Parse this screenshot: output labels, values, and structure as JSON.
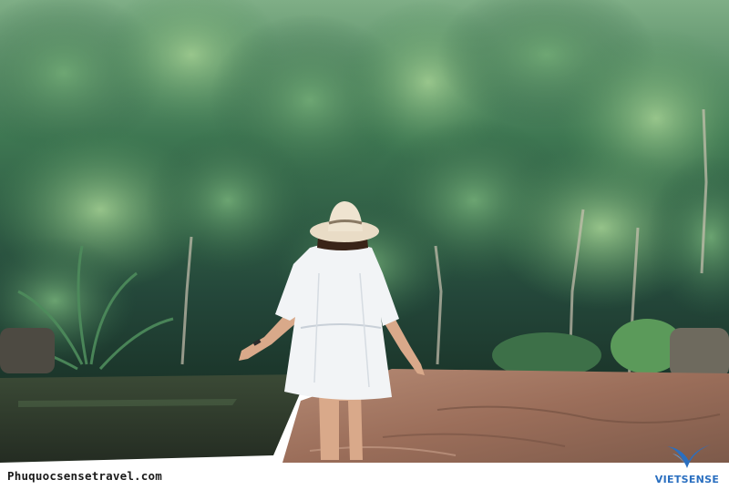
{
  "photo": {
    "subject": "woman-in-white-dress-and-sun-hat",
    "colors": {
      "forest_dark": "#1f3b2a",
      "forest_mid": "#3f7a4e",
      "forest_light": "#8fbf7f",
      "water": "#2e3a2c",
      "rock": "#9a6f5c",
      "dress": "#f2f4f6",
      "hat": "#e9dcc6",
      "skin": "#d9a98a",
      "hair": "#3a2418"
    }
  },
  "watermark": {
    "url_text": "Phuquocsensetravel.com",
    "brand_name": "VIETSENSE",
    "brand_color": "#2a6fc0"
  }
}
